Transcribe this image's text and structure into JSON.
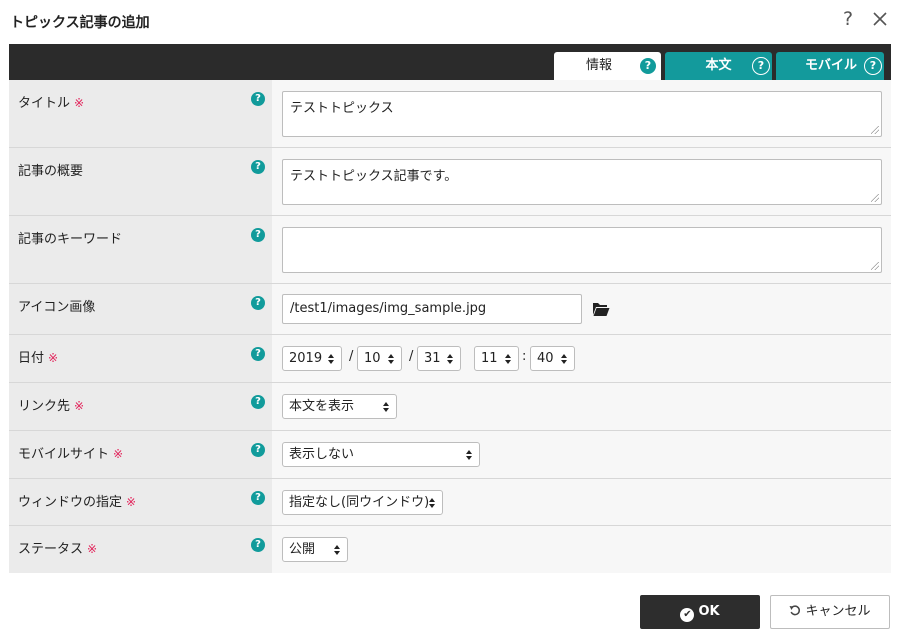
{
  "dialog": {
    "title": "トピックス記事の追加",
    "help_glyph": "?",
    "close_icon": "close-icon"
  },
  "tabs": [
    {
      "label": "情報",
      "active": true
    },
    {
      "label": "本文",
      "active": false
    },
    {
      "label": "モバイル",
      "active": false
    }
  ],
  "help_glyph": "?",
  "required_mark": "※",
  "fields": {
    "title": {
      "label": "タイトル",
      "required": true,
      "value": "テストトピックス"
    },
    "summary": {
      "label": "記事の概要",
      "required": false,
      "value": "テストトピックス記事です。"
    },
    "keywords": {
      "label": "記事のキーワード",
      "required": false,
      "value": ""
    },
    "icon_image": {
      "label": "アイコン画像",
      "required": false,
      "value": "/test1/images/img_sample.jpg",
      "icon": "folder-open-icon"
    },
    "date": {
      "label": "日付",
      "required": true,
      "year": "2019",
      "month": "10",
      "day": "31",
      "hour": "11",
      "minute": "40",
      "date_sep": "/",
      "time_sep": ":"
    },
    "link": {
      "label": "リンク先",
      "required": true,
      "selected": "本文を表示"
    },
    "mobile_site": {
      "label": "モバイルサイト",
      "required": true,
      "selected": "表示しない"
    },
    "window": {
      "label": "ウィンドウの指定",
      "required": true,
      "selected": "指定なし(同ウインドウ)"
    },
    "status": {
      "label": "ステータス",
      "required": true,
      "selected": "公開"
    }
  },
  "footer": {
    "ok_label": "OK",
    "cancel_label": "キャンセル"
  },
  "colors": {
    "accent": "#139a9c",
    "required": "#e2245b",
    "tabbar": "#2b2b2b",
    "ok_button": "#2d2d2d"
  }
}
